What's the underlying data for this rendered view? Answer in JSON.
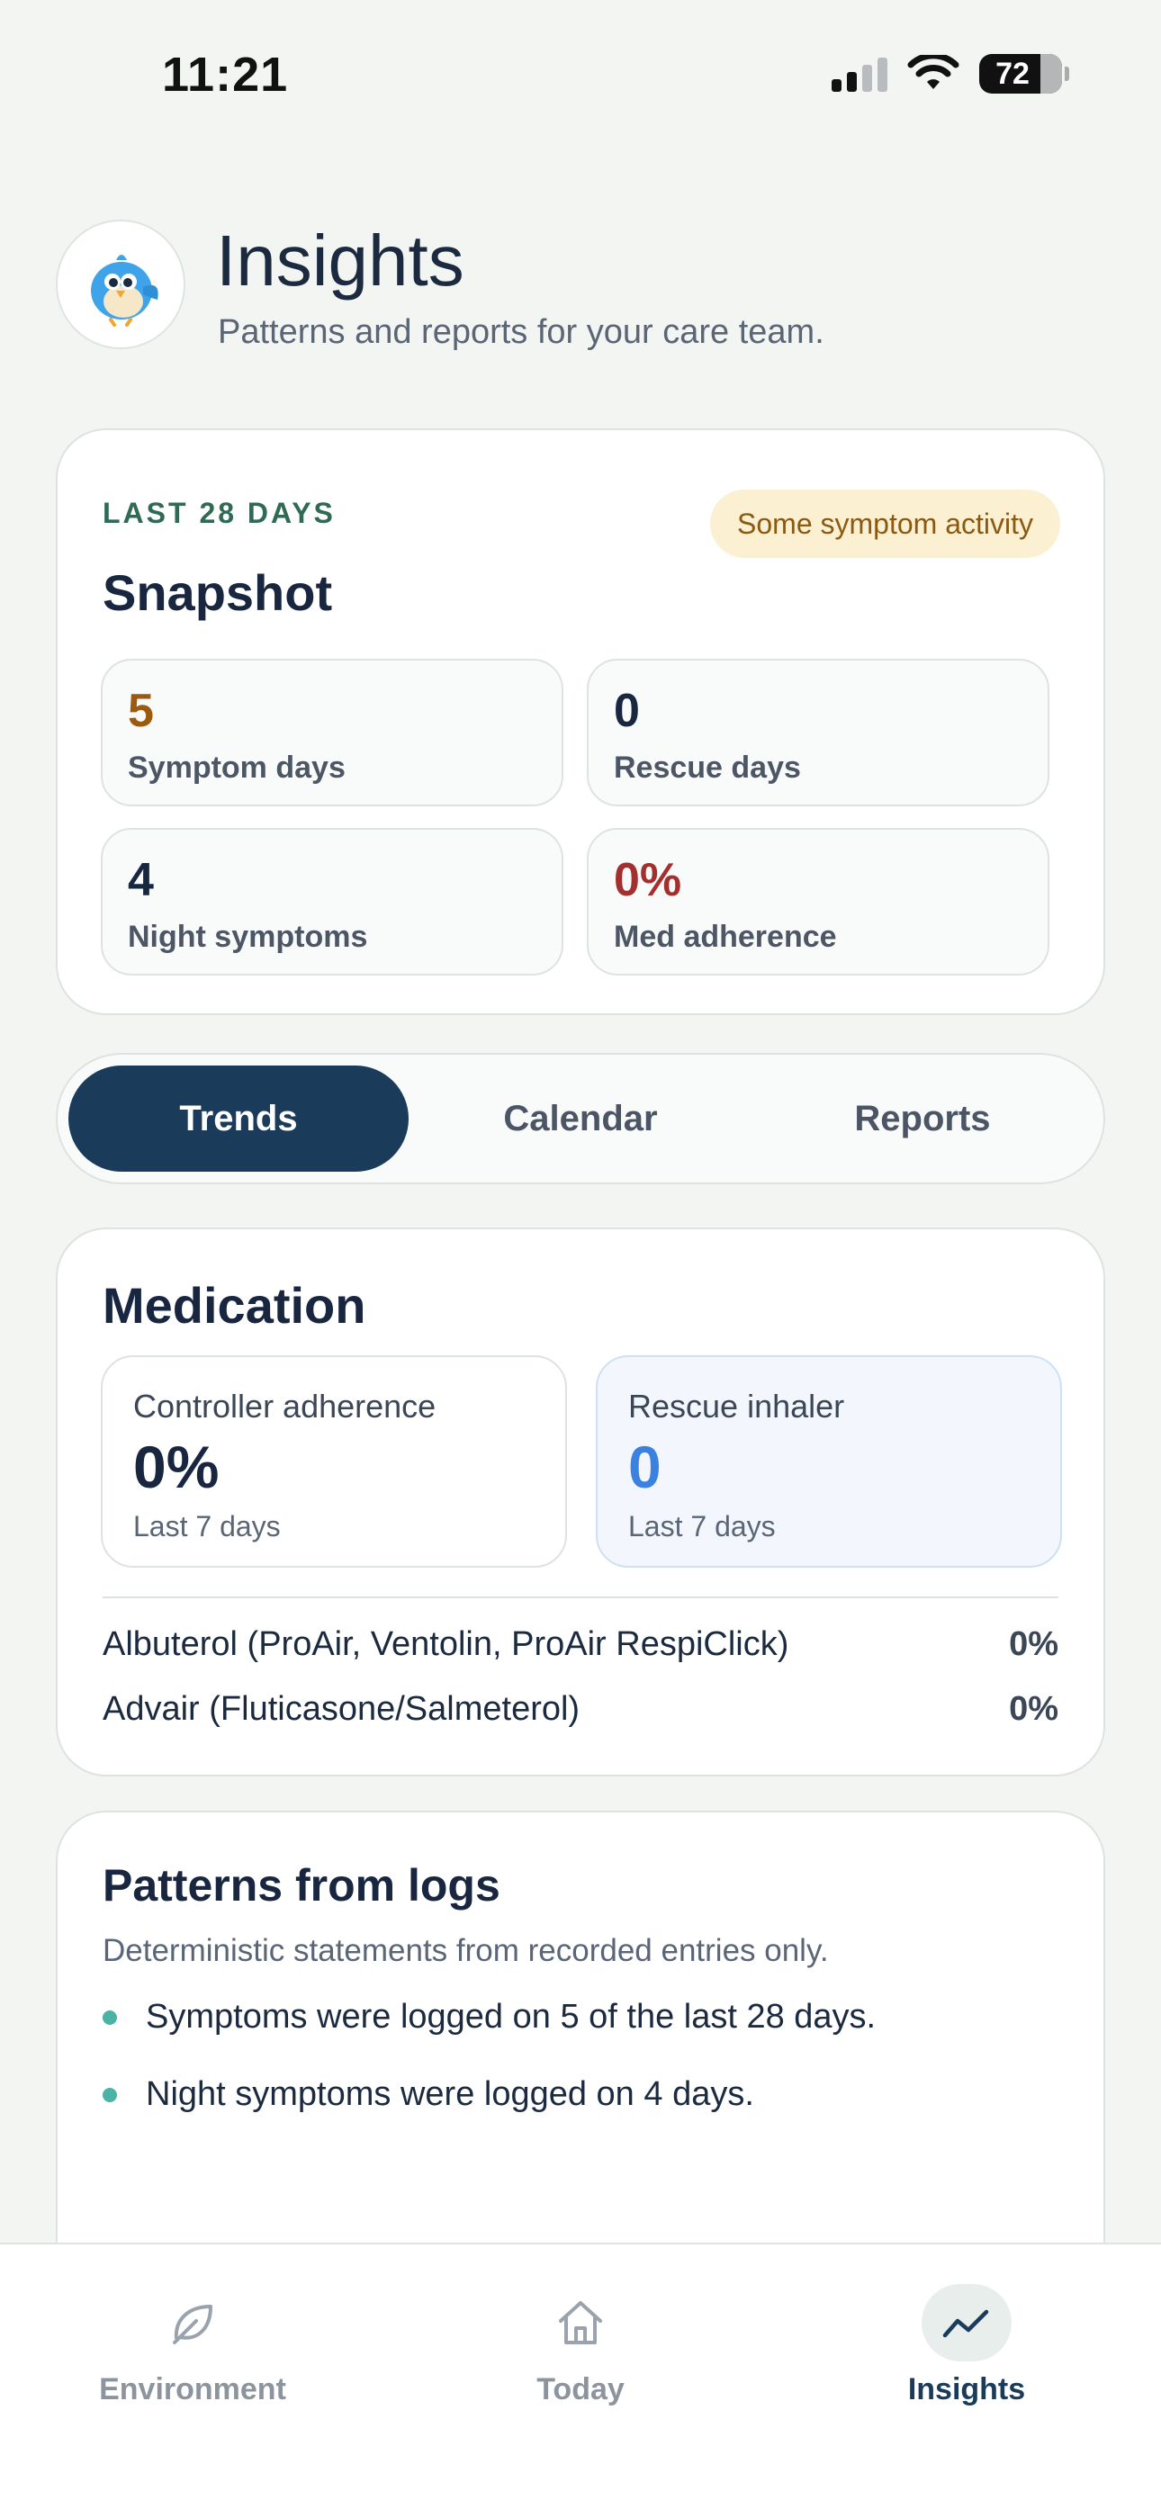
{
  "status_bar": {
    "time": "11:21",
    "battery": "72"
  },
  "header": {
    "title": "Insights",
    "subtitle": "Patterns and reports for your care team.",
    "avatar_icon": "bluebird-mascot-icon"
  },
  "snapshot": {
    "eyebrow": "LAST 28 DAYS",
    "status": "Some symptom activity",
    "title": "Snapshot",
    "stats": [
      {
        "value": "5",
        "label": "Symptom days",
        "color": "#9b5a10"
      },
      {
        "value": "0",
        "label": "Rescue days",
        "color": "#182640"
      },
      {
        "value": "4",
        "label": "Night symptoms",
        "color": "#182640"
      },
      {
        "value": "0%",
        "label": "Med adherence",
        "color": "#a3302e"
      }
    ]
  },
  "tabs": [
    {
      "label": "Trends",
      "active": true
    },
    {
      "label": "Calendar",
      "active": false
    },
    {
      "label": "Reports",
      "active": false
    }
  ],
  "medication": {
    "title": "Medication",
    "controller": {
      "label": "Controller adherence",
      "value": "0%",
      "period": "Last 7 days"
    },
    "rescue": {
      "label": "Rescue inhaler",
      "value": "0",
      "period": "Last 7 days"
    },
    "rows": [
      {
        "name": "Albuterol (ProAir, Ventolin, ProAir RespiClick)",
        "pct": "0%"
      },
      {
        "name": "Advair (Fluticasone/Salmeterol)",
        "pct": "0%"
      }
    ]
  },
  "patterns": {
    "title": "Patterns from logs",
    "subtitle": "Deterministic statements from recorded entries only.",
    "items": [
      "Symptoms were logged on 5 of the last 28 days.",
      "Night symptoms were logged on 4 days."
    ]
  },
  "nav": [
    {
      "label": "Environment",
      "icon": "leaf-icon",
      "active": false
    },
    {
      "label": "Today",
      "icon": "home-icon",
      "active": false
    },
    {
      "label": "Insights",
      "icon": "trend-line-icon",
      "active": true
    }
  ]
}
